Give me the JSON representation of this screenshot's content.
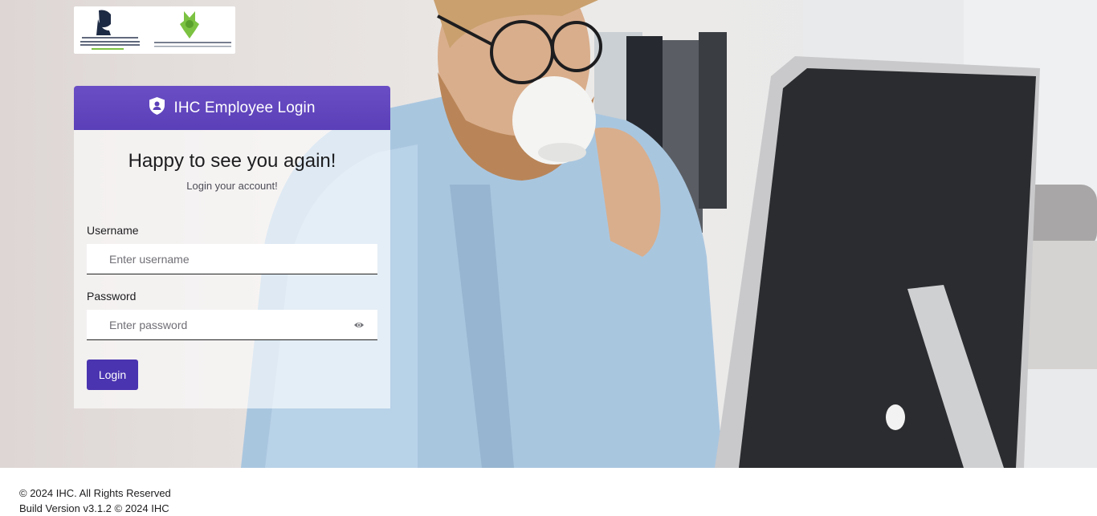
{
  "header": {
    "title": "IHC Employee Login"
  },
  "greeting": {
    "title": "Happy to see you again!",
    "subtitle": "Login your account!"
  },
  "form": {
    "username_label": "Username",
    "username_placeholder": "Enter username",
    "username_value": "",
    "password_label": "Password",
    "password_placeholder": "Enter password",
    "password_value": "",
    "login_label": "Login"
  },
  "footer": {
    "copyright": "© 2024 IHC. All Rights Reserved",
    "build": "Build Version v3.1.2 © 2024 IHC"
  },
  "logos": {
    "left_logo_icon": "mbrgi-logo",
    "right_logo_icon": "ihc-logo",
    "left_logo_text": "Mohammed bin Rashid Al Maktoum Global Initiatives",
    "right_logo_text": "INTERNATIONAL HUMANITARIAN CITY"
  },
  "colors": {
    "accent": "#5a3fb8",
    "button": "#4b34b0",
    "logo_green": "#7cc242"
  },
  "icons": {
    "header_icon": "shield-user-icon",
    "password_toggle": "eye-icon"
  }
}
